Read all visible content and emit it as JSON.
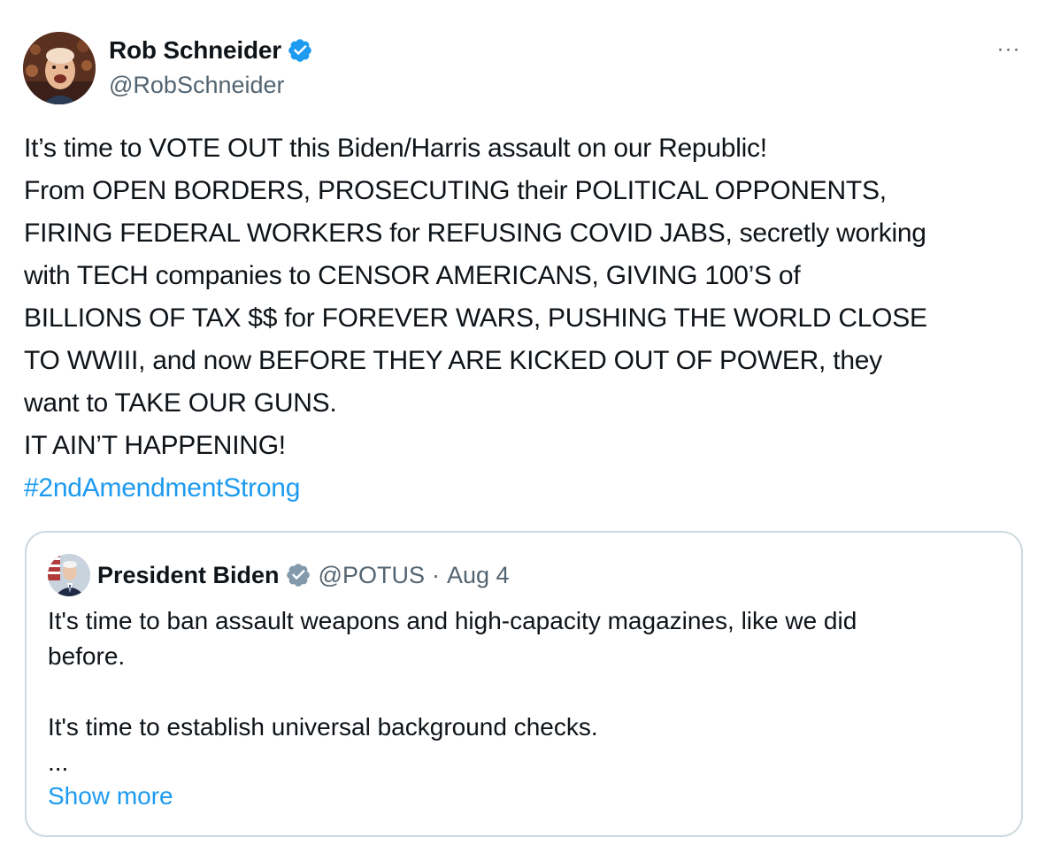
{
  "author": {
    "display_name": "Rob Schneider",
    "handle": "@RobSchneider",
    "verified": true,
    "avatar_icon": "profile-photo"
  },
  "more_icon": "more-horizontal-icon",
  "more_label": "···",
  "tweet": {
    "lines": [
      "It’s time to VOTE OUT this Biden/Harris assault on our Republic!",
      "From OPEN BORDERS, PROSECUTING their POLITICAL OPPONENTS,",
      "FIRING FEDERAL WORKERS for REFUSING COVID JABS, secretly working",
      "with TECH companies to CENSOR AMERICANS, GIVING 100’S of",
      "BILLIONS OF TAX $$ for FOREVER WARS, PUSHING THE WORLD CLOSE",
      "TO WWIII, and now BEFORE THEY ARE KICKED OUT OF POWER, they",
      "want to TAKE OUR GUNS.",
      "IT AIN’T HAPPENING!"
    ],
    "hashtag": "#2ndAmendmentStrong"
  },
  "quoted_tweet": {
    "display_name": "President Biden",
    "handle": "@POTUS",
    "separator": "·",
    "date": "Aug 4",
    "verified_gray": true,
    "lines": [
      "It's time to ban assault weapons and high-capacity magazines, like we did",
      "before.",
      "",
      "It's time to establish universal background checks.",
      "..."
    ],
    "show_more": "Show more"
  },
  "colors": {
    "text": "#0f1419",
    "secondary": "#536471",
    "link": "#1d9bf0",
    "verified_blue": "#1d9bf0",
    "verified_gray": "#829aab",
    "border": "#cfd9de"
  }
}
